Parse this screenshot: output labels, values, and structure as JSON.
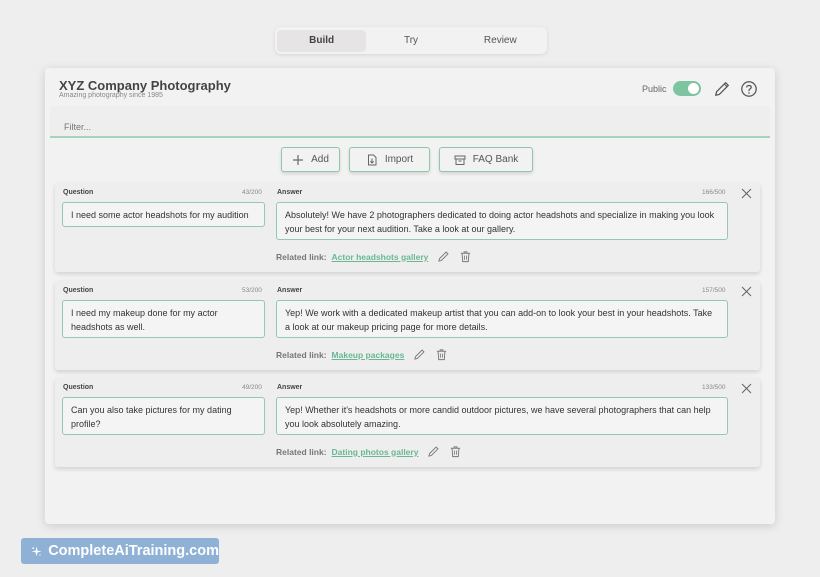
{
  "tabs": [
    {
      "label": "Build",
      "active": true
    },
    {
      "label": "Try",
      "active": false
    },
    {
      "label": "Review",
      "active": false
    }
  ],
  "header": {
    "title": "XYZ Company Photography",
    "subtitle": "Amazing photography since 1985",
    "public_label": "Public",
    "public_on": true
  },
  "filter": {
    "placeholder": "Filter..."
  },
  "actions": {
    "add": "Add",
    "import": "Import",
    "faq_bank": "FAQ Bank"
  },
  "labels": {
    "question": "Question",
    "answer": "Answer",
    "related_link": "Related link:"
  },
  "qa": [
    {
      "question": "I need some actor headshots for my audition",
      "question_count": "43/200",
      "answer": "Absolutely! We have 2 photographers dedicated to doing actor headshots and specialize in making you look your best for your next audition. Take a look at our gallery.",
      "answer_count": "166/500",
      "link": "Actor headshots gallery"
    },
    {
      "question": "I need my makeup done for my actor headshots as well.",
      "question_count": "53/200",
      "answer": "Yep! We work with a dedicated makeup artist that you can add-on to look your best in your headshots. Take a look at our makeup pricing page for more details.",
      "answer_count": "157/500",
      "link": "Makeup packages"
    },
    {
      "question": "Can you also take pictures for my dating profile?",
      "question_count": "49/200",
      "answer": "Yep! Whether it's headshots or more candid outdoor pictures, we have several photographers that can help you look absolutely amazing.",
      "answer_count": "133/500",
      "link": "Dating photos gallery"
    }
  ],
  "watermark": "CompleteAiTraining.com",
  "colors": {
    "accent": "#7cc4a2",
    "border_green": "#93c9ae",
    "background": "#efeeee",
    "watermark_bg": "#8fb1d6"
  }
}
